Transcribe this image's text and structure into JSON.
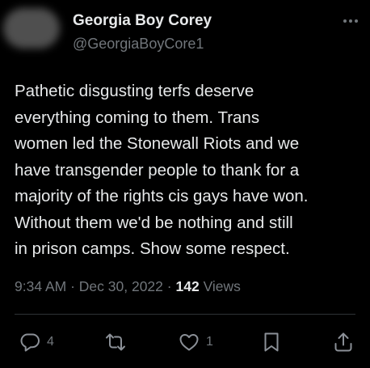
{
  "author": {
    "display_name": "Georgia Boy Corey",
    "handle": "@GeorgiaBoyCore1",
    "avatar_icon": "blurred-avatar"
  },
  "tweet": {
    "text": "Pathetic disgusting terfs deserve\neverything coming to them. Trans\nwomen led the Stonewall Riots and we\nhave transgender people to thank for a\nmajority of the rights cis gays have won.\nWithout them we'd be nothing and still\nin prison camps. Show some respect."
  },
  "meta": {
    "time": "9:34 AM",
    "separator": "·",
    "date": "Dec 30, 2022",
    "views_count": "142",
    "views_label": "Views"
  },
  "actions": {
    "reply": {
      "icon": "reply-icon",
      "count": "4"
    },
    "retweet": {
      "icon": "retweet-icon",
      "count": ""
    },
    "like": {
      "icon": "heart-icon",
      "count": "1"
    },
    "bookmark": {
      "icon": "bookmark-icon"
    },
    "share": {
      "icon": "share-icon"
    }
  },
  "colors": {
    "background": "#000000",
    "primary_text": "#e7e9ea",
    "secondary_text": "#71767b",
    "divider": "#2f3336"
  }
}
